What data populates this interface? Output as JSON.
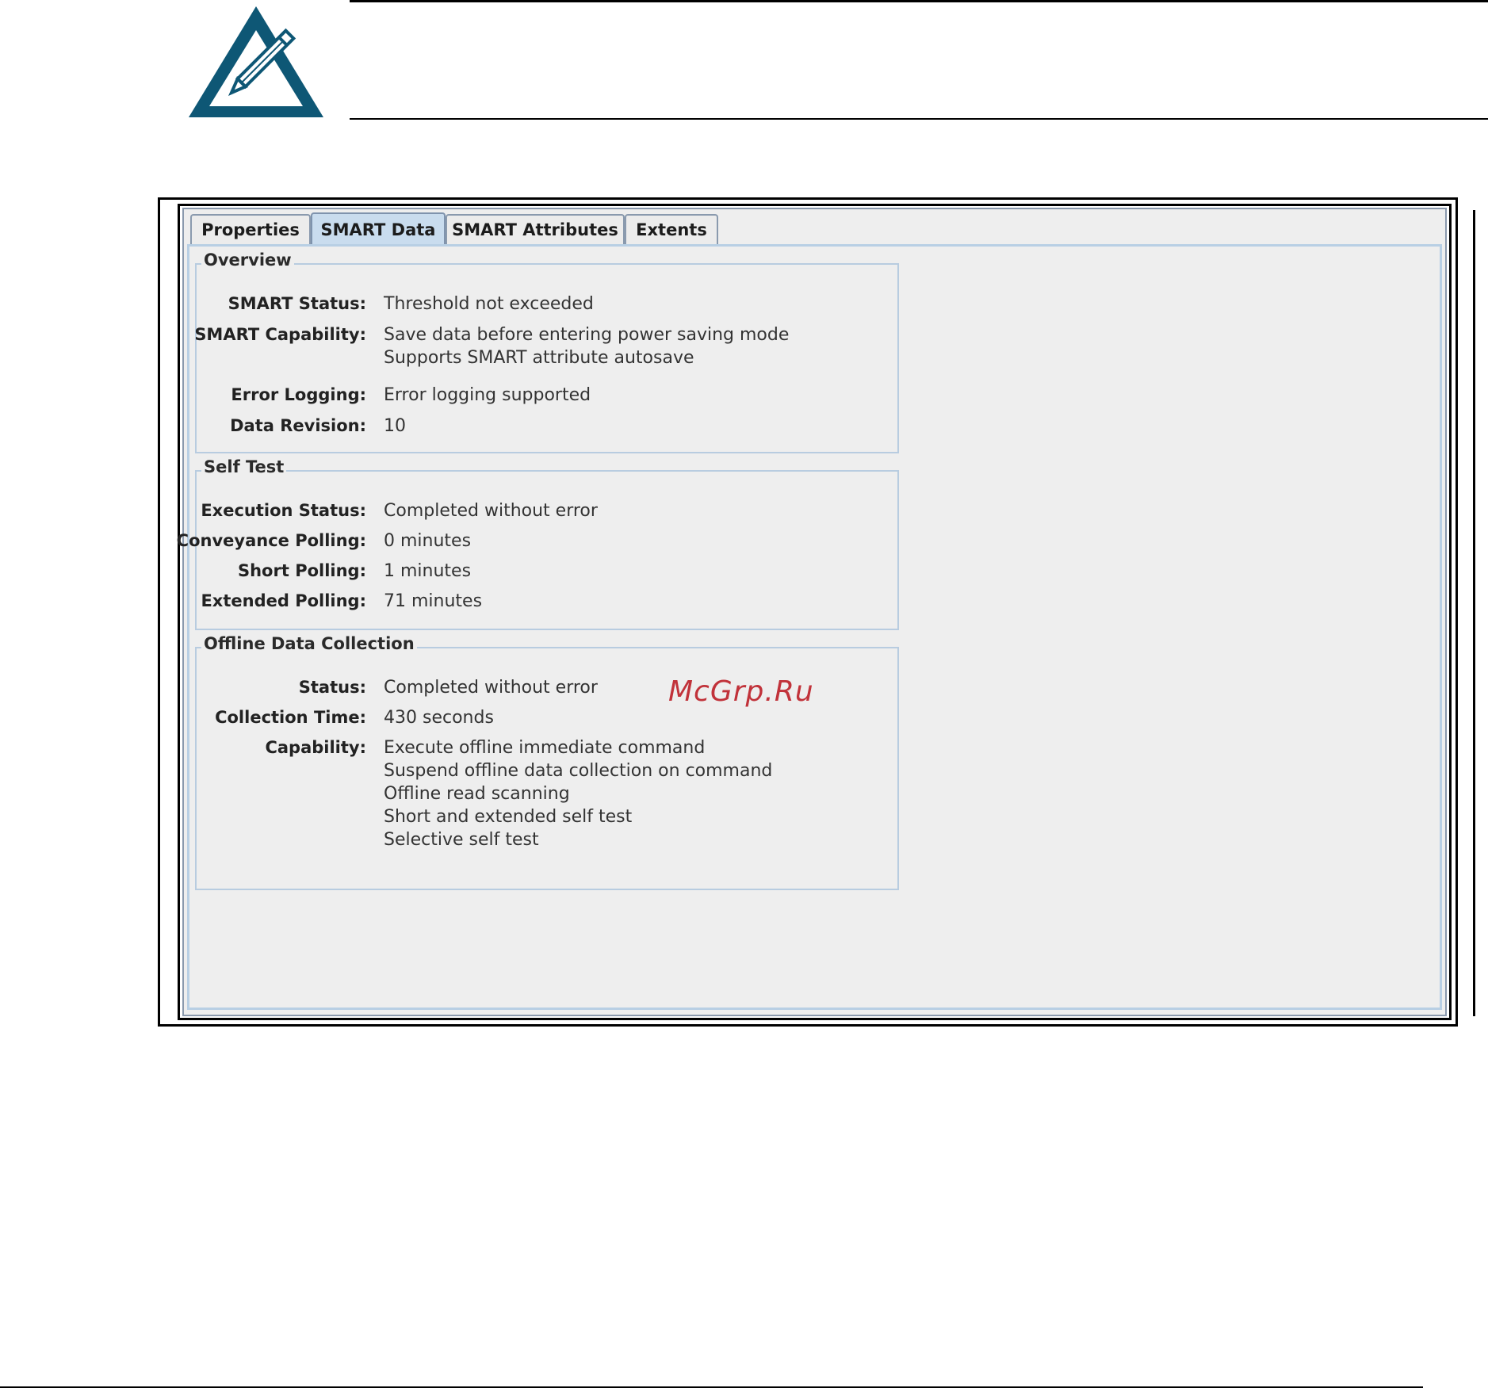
{
  "tabs": [
    {
      "label": "Properties",
      "active": false
    },
    {
      "label": "SMART Data",
      "active": true
    },
    {
      "label": "SMART Attributes",
      "active": false
    },
    {
      "label": "Extents",
      "active": false
    }
  ],
  "overview": {
    "title": "Overview",
    "smart_status": {
      "label": "SMART Status:",
      "value": "Threshold not exceeded"
    },
    "smart_capability": {
      "label": "SMART Capability:",
      "values": [
        "Save data before entering power saving mode",
        "Supports SMART attribute autosave"
      ]
    },
    "error_logging": {
      "label": "Error Logging:",
      "value": "Error logging supported"
    },
    "data_revision": {
      "label": "Data Revision:",
      "value": "10"
    }
  },
  "self_test": {
    "title": "Self Test",
    "execution_status": {
      "label": "Execution Status:",
      "value": "Completed without error"
    },
    "conveyance_polling": {
      "label": "Conveyance Polling:",
      "value": "0 minutes"
    },
    "short_polling": {
      "label": "Short Polling:",
      "value": "1 minutes"
    },
    "extended_polling": {
      "label": "Extended Polling:",
      "value": "71 minutes"
    }
  },
  "offline": {
    "title": "Offline Data Collection",
    "status": {
      "label": "Status:",
      "value": "Completed without error"
    },
    "collection_time": {
      "label": "Collection Time:",
      "value": "430 seconds"
    },
    "capability": {
      "label": "Capability:",
      "values": [
        "Execute offline immediate command",
        "Suspend offline data collection on command",
        "Offline read scanning",
        "Short and extended self test",
        "Selective self test"
      ]
    }
  },
  "watermark": "McGrp.Ru",
  "colors": {
    "note_icon": "#0e5775",
    "active_tab": "#c9dcee",
    "panel_border": "#b8cfe4",
    "watermark": "#c1323a"
  }
}
